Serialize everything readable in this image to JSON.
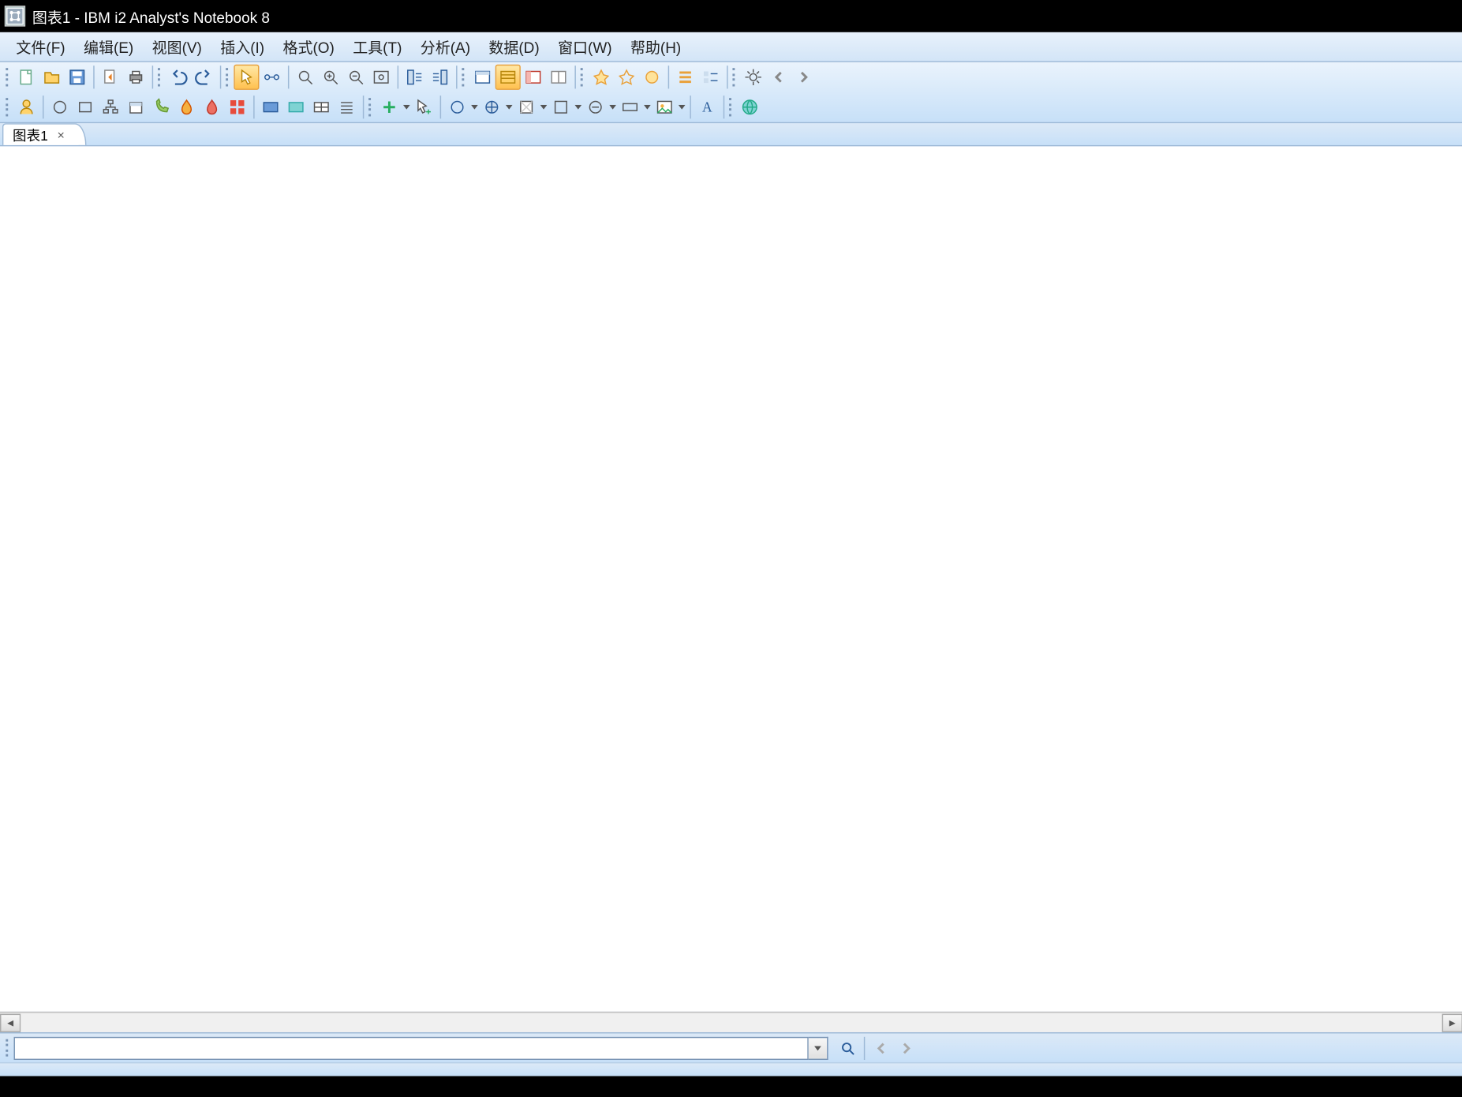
{
  "title": "图表1 - IBM i2 Analyst's Notebook 8",
  "menu": {
    "file": "文件(F)",
    "edit": "编辑(E)",
    "view": "视图(V)",
    "insert": "插入(I)",
    "format": "格式(O)",
    "tools": "工具(T)",
    "analyze": "分析(A)",
    "data": "数据(D)",
    "window": "窗口(W)",
    "help": "帮助(H)"
  },
  "toolbar1": {
    "icons": [
      "new-file",
      "open-file",
      "save-file",
      "sep",
      "import",
      "print",
      "sep",
      "undo",
      "redo",
      "sep",
      "pointer",
      "link",
      "sep",
      "find",
      "zoom-in",
      "zoom-out",
      "fit",
      "sep",
      "layout-left",
      "layout-right",
      "sep",
      "pane-1",
      "pane-2",
      "pane-3",
      "pane-4",
      "sep",
      "spark-1",
      "spark-2",
      "spark-3",
      "sep",
      "highlight",
      "list-view",
      "sep",
      "settings",
      "nav-prev",
      "nav-next"
    ]
  },
  "toolbar2": {
    "icons": [
      "entity",
      "circle",
      "box",
      "org",
      "event",
      "phone",
      "flame-1",
      "flame-2",
      "grid",
      "sep",
      "card-blue",
      "card-cyan",
      "card-grid",
      "list",
      "sep",
      "add-dd",
      "ptr-add",
      "sep",
      "circle-dd",
      "decor-dd",
      "shape-dd",
      "square-dd",
      "minus-dd",
      "rect-dd",
      "image-dd",
      "sep",
      "text",
      "sep",
      "globe"
    ]
  },
  "tabs": [
    {
      "label": "图表1"
    }
  ],
  "search": {
    "placeholder": ""
  }
}
